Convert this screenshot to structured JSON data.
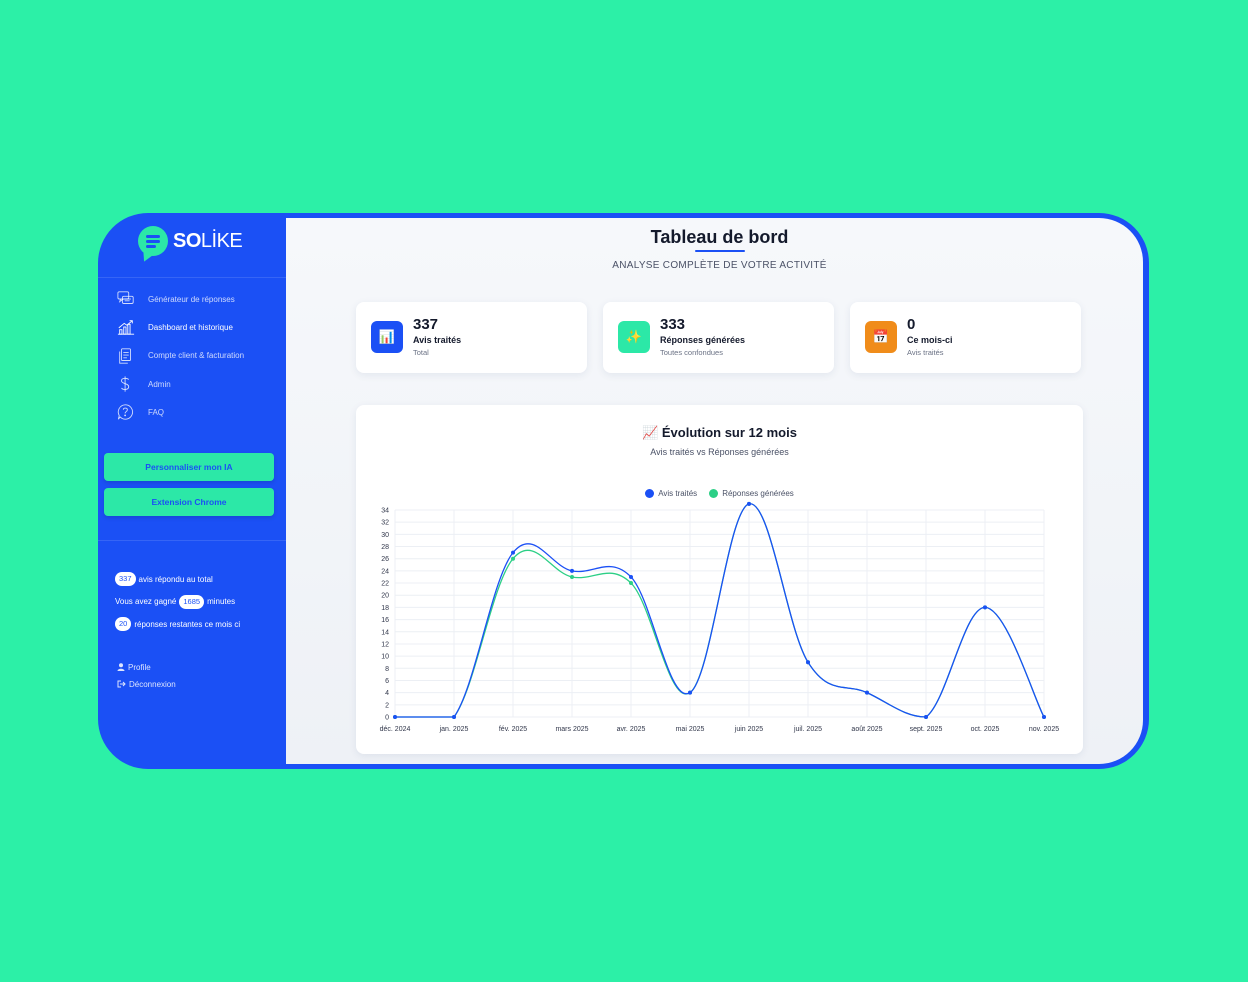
{
  "brand": {
    "name_bold": "SO",
    "name_light": "LİKE"
  },
  "nav": [
    {
      "label": "Générateur de réponses",
      "icon": "chat-bubbles-icon",
      "active": false
    },
    {
      "label": "Dashboard et historique",
      "icon": "growth-chart-icon",
      "active": true
    },
    {
      "label": "Compte client & facturation",
      "icon": "documents-icon",
      "active": false
    },
    {
      "label": "Admin",
      "icon": "dollar-icon",
      "active": false
    },
    {
      "label": "FAQ",
      "icon": "question-icon",
      "active": false
    }
  ],
  "buttons": {
    "personalize": "Personnaliser mon IA",
    "extension": "Extension Chrome"
  },
  "stats": {
    "total_count": "337",
    "total_text": "avis répondu au total",
    "saved_prefix": "Vous avez gagné",
    "saved_minutes": "1685",
    "saved_suffix": "minutes",
    "remaining_count": "20",
    "remaining_text": "réponses restantes ce mois ci"
  },
  "links": {
    "profile": "Profile",
    "logout": "Déconnexion"
  },
  "header": {
    "title": "Tableau de bord",
    "subtitle": "ANALYSE COMPLÈTE DE VOTRE ACTIVITÉ"
  },
  "cards": [
    {
      "value": "337",
      "label": "Avis traités",
      "sub": "Total",
      "icon": "📊",
      "color": "#1b50f5"
    },
    {
      "value": "333",
      "label": "Réponses générées",
      "sub": "Toutes confondues",
      "icon": "✨",
      "color": "#2ce8a7"
    },
    {
      "value": "0",
      "label": "Ce mois-ci",
      "sub": "Avis traités",
      "icon": "📅",
      "color": "#f08c1a"
    }
  ],
  "chart_header": {
    "icon": "📈",
    "title": "Évolution sur 12 mois",
    "subtitle": "Avis traités vs Réponses générées"
  },
  "chart_data": {
    "type": "line",
    "title": "Évolution sur 12 mois",
    "subtitle": "Avis traités vs Réponses générées",
    "categories": [
      "déc. 2024",
      "janv. 2025",
      "févr. 2025",
      "mars 2025",
      "avr. 2025",
      "mai 2025",
      "juin 2025",
      "juil. 2025",
      "août 2025",
      "sept. 2025",
      "oct. 2025",
      "nov. 2025"
    ],
    "tick_labels": [
      "déc. 2024",
      "jan. 2025",
      "fév. 2025",
      "mars 2025",
      "avr. 2025",
      "mai 2025",
      "juin 2025",
      "juil. 2025",
      "août 2025",
      "sept. 2025",
      "oct. 2025",
      "nov. 2025"
    ],
    "series": [
      {
        "name": "Avis traités",
        "color": "#1b50f5",
        "values": [
          0,
          0,
          27,
          24,
          23,
          4,
          35,
          9,
          4,
          0,
          18,
          0
        ]
      },
      {
        "name": "Réponses générées",
        "color": "#2ccf86",
        "values": [
          0,
          0,
          26,
          23,
          22,
          4,
          35,
          9,
          4,
          0,
          18,
          0
        ]
      }
    ],
    "ylim": [
      0,
      34
    ],
    "yticks": [
      0,
      2,
      4,
      6,
      8,
      10,
      12,
      14,
      16,
      18,
      20,
      22,
      24,
      26,
      28,
      30,
      32,
      34
    ],
    "grid": true,
    "legend": "top-center"
  }
}
